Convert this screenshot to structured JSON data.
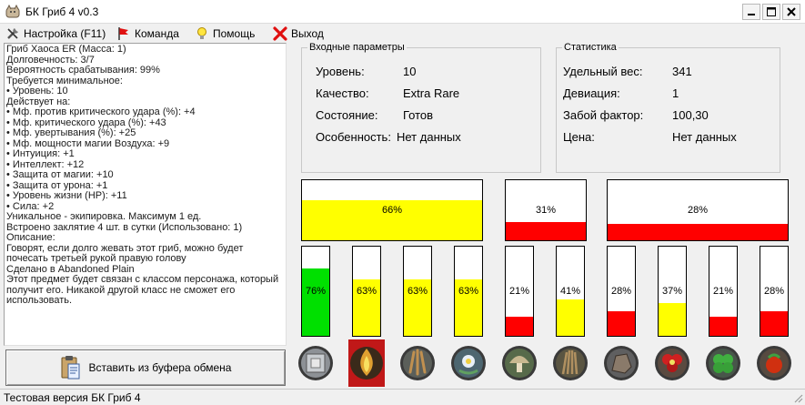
{
  "window": {
    "title": "БК Гриб 4 v0.3"
  },
  "menu": {
    "settings": "Настройка (F11)",
    "team": "Команда",
    "help": "Помощь",
    "exit": "Выход"
  },
  "item_info": [
    "Гриб Хаоса  ER   (Масса: 1)",
    "Долговечность: 3/7",
    "Вероятность срабатывания: 99%",
    "Требуется минимальное:",
    "• Уровень: 10",
    "Действует на:",
    "• Мф. против критического удара (%): +4",
    "• Мф. критического удара (%): +43",
    "• Мф. увертывания (%): +25",
    "• Мф. мощности магии Воздуха: +9",
    "• Интуиция: +1",
    "• Интеллект: +12",
    "• Защита от магии: +10",
    "• Защита от урона: +1",
    "• Уровень жизни (HP): +11",
    "• Сила: +2",
    "Уникальное - экипировка. Максимум 1 ед.",
    "Встроено заклятие  4 шт. в сутки (Использовано: 1)",
    "Описание:",
    "Говорят, если долго жевать этот гриб, можно будет почесать третьей рукой правую голову",
    "Сделано в Abandoned Plain",
    "Этот предмет будет связан с классом персонажа, который получит его. Никакой другой класс не сможет его использовать."
  ],
  "paste_button": "Вставить из буфера обмена",
  "input_params": {
    "legend": "Входные параметры",
    "rows": [
      {
        "label": "Уровень:",
        "value": "10"
      },
      {
        "label": "Качество:",
        "value": "Extra Rare"
      },
      {
        "label": "Состояние:",
        "value": "Готов"
      },
      {
        "label": "Особенность:",
        "value": "Нет данных"
      }
    ]
  },
  "statistics": {
    "legend": "Статистика",
    "rows": [
      {
        "label": "Удельный вес:",
        "value": "341"
      },
      {
        "label": "Девиация:",
        "value": "1"
      },
      {
        "label": "Забой фактор:",
        "value": "100,30"
      },
      {
        "label": "Цена:",
        "value": "Нет данных"
      }
    ]
  },
  "colors": {
    "yellow": "#ffff00",
    "red": "#ff0000",
    "green": "#00e000"
  },
  "hbars": [
    {
      "label": "66%",
      "value": 66,
      "color": "yellow"
    },
    {
      "label": "31%",
      "value": 31,
      "color": "red"
    },
    {
      "label": "28%",
      "value": 28,
      "color": "red"
    }
  ],
  "vbars": [
    {
      "label": "76%",
      "value": 76,
      "color": "green"
    },
    {
      "label": "63%",
      "value": 63,
      "color": "yellow"
    },
    {
      "label": "63%",
      "value": 63,
      "color": "yellow"
    },
    {
      "label": "63%",
      "value": 63,
      "color": "yellow"
    },
    {
      "label": "21%",
      "value": 21,
      "color": "red"
    },
    {
      "label": "41%",
      "value": 41,
      "color": "yellow"
    },
    {
      "label": "28%",
      "value": 28,
      "color": "red"
    },
    {
      "label": "37%",
      "value": 37,
      "color": "yellow"
    },
    {
      "label": "21%",
      "value": 21,
      "color": "red"
    },
    {
      "label": "28%",
      "value": 28,
      "color": "red"
    }
  ],
  "slots": [
    "metal-box-icon",
    "flame-icon",
    "claw-icon",
    "flower-icon",
    "mushroom-icon",
    "bundle-icon",
    "rock-icon",
    "red-flower-icon",
    "clover-icon",
    "berry-icon"
  ],
  "status": "Тестовая версия БК Гриб 4"
}
